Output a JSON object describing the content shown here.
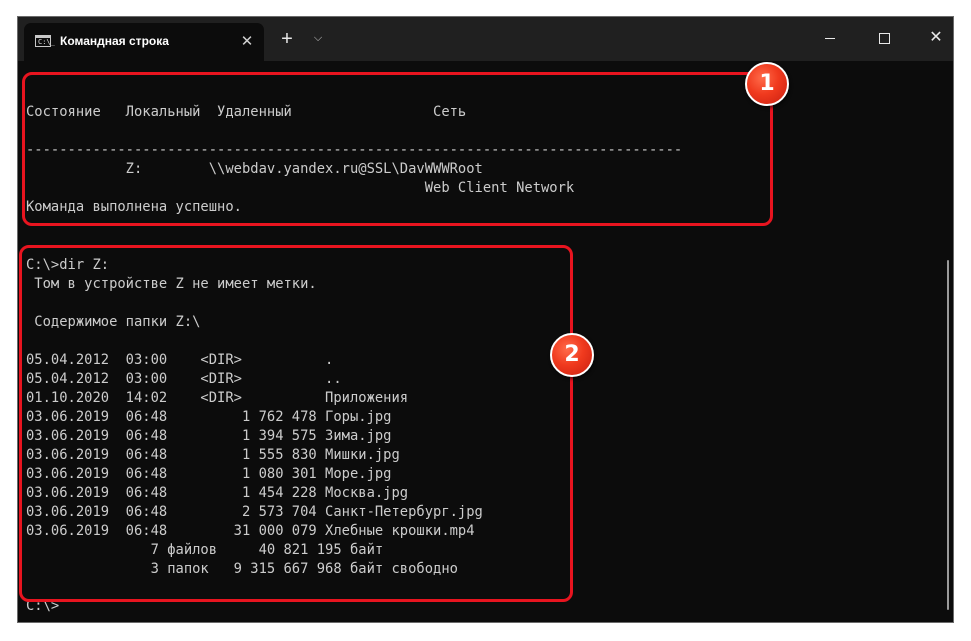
{
  "window": {
    "tab_title": "Командная строка",
    "tab_icon_text": "C:\\_",
    "tab_close_glyph": "✕",
    "new_tab_glyph": "+",
    "dropdown_glyph": "⌵",
    "close_glyph": "✕"
  },
  "console": {
    "lines": [
      "",
      "Состояние   Локальный  Удаленный                 Сеть",
      "",
      "-------------------------------------------------------------------------------",
      "            Z:        \\\\webdav.yandex.ru@SSL\\DavWWWRoot",
      "                                                Web Client Network",
      "Команда выполнена успешно.",
      "",
      "",
      "C:\\>dir Z:",
      " Том в устройстве Z не имеет метки.",
      "",
      " Содержимое папки Z:\\",
      "",
      "05.04.2012  03:00    <DIR>          .",
      "05.04.2012  03:00    <DIR>          ..",
      "01.10.2020  14:02    <DIR>          Приложения",
      "03.06.2019  06:48         1 762 478 Горы.jpg",
      "03.06.2019  06:48         1 394 575 Зима.jpg",
      "03.06.2019  06:48         1 555 830 Мишки.jpg",
      "03.06.2019  06:48         1 080 301 Море.jpg",
      "03.06.2019  06:48         1 454 228 Москва.jpg",
      "03.06.2019  06:48         2 573 704 Санкт-Петербург.jpg",
      "03.06.2019  06:48        31 000 079 Хлебные крошки.mp4",
      "               7 файлов     40 821 195 байт",
      "               3 папок   9 315 667 968 байт свободно",
      "",
      "C:\\>"
    ]
  },
  "callouts": [
    {
      "label": "1",
      "color": "#e8141f"
    },
    {
      "label": "2",
      "color": "#e8141f"
    }
  ]
}
